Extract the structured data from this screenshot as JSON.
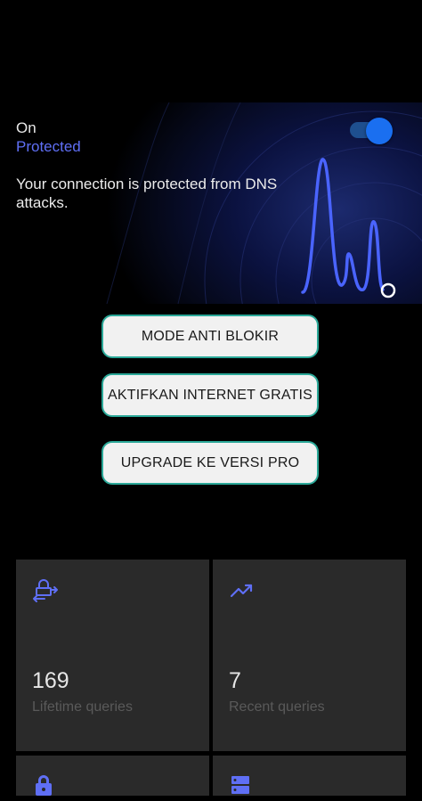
{
  "status": {
    "state": "On",
    "label": "Protected",
    "description": "Your connection is protected from DNS attacks.",
    "toggle_on": true
  },
  "colors": {
    "accent": "#5f6ff5",
    "toggle": "#1a6ff0",
    "button_border": "#2aa898",
    "card_bg": "#2a2a2a"
  },
  "buttons": [
    {
      "label": "MODE ANTI BLOKIR"
    },
    {
      "label": "AKTIFKAN INTERNET GRATIS"
    },
    {
      "label": "UPGRADE KE VERSI PRO"
    }
  ],
  "stats": [
    {
      "icon": "lock-transfer-icon",
      "value": "169",
      "label": "Lifetime queries"
    },
    {
      "icon": "trending-up-icon",
      "value": "7",
      "label": "Recent queries"
    },
    {
      "icon": "lock-icon"
    },
    {
      "icon": "server-icon"
    }
  ]
}
